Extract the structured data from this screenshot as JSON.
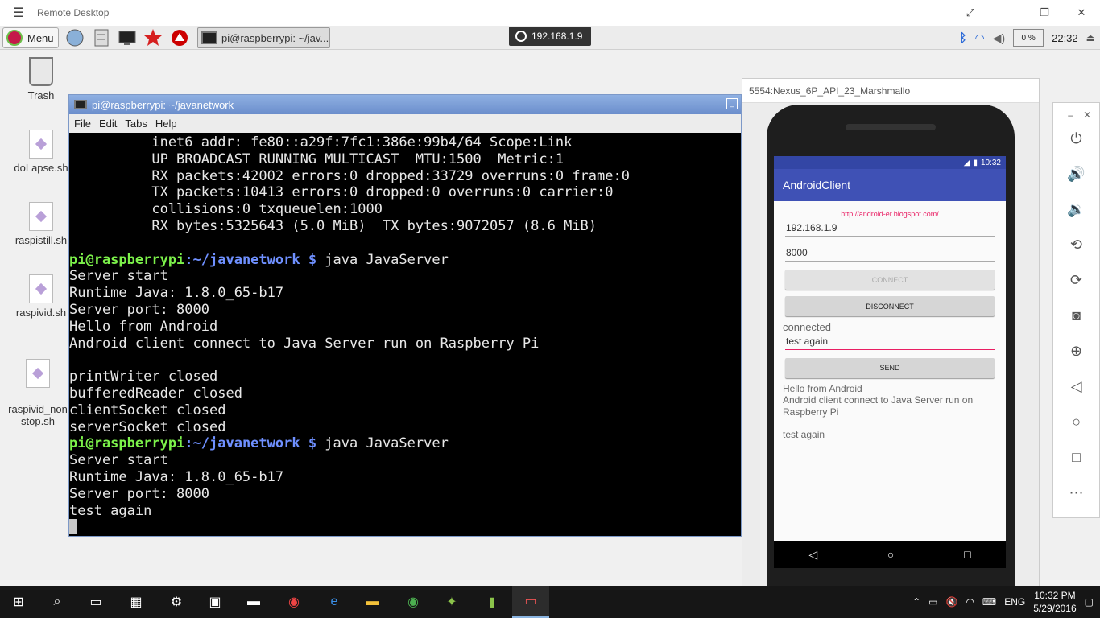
{
  "remote_desktop": {
    "title": "Remote Desktop",
    "connection": "192.168.1.9"
  },
  "pi_panel": {
    "menu_label": "Menu",
    "task_terminal": "pi@raspberrypi: ~/jav...",
    "cpu": "0 %",
    "clock": "22:32"
  },
  "desktop_icons": [
    "Trash",
    "doLapse.sh",
    "raspistill.sh",
    "raspivid.sh",
    "raspivid_non\nstop.sh"
  ],
  "terminal": {
    "title": "pi@raspberrypi: ~/javanetwork",
    "menu": [
      "File",
      "Edit",
      "Tabs",
      "Help"
    ],
    "prompt_user": "pi@raspberrypi",
    "prompt_path": ":~/javanetwork $",
    "command": " java JavaServer",
    "lines_top": [
      "          inet6 addr: fe80::a29f:7fc1:386e:99b4/64 Scope:Link",
      "          UP BROADCAST RUNNING MULTICAST  MTU:1500  Metric:1",
      "          RX packets:42002 errors:0 dropped:33729 overruns:0 frame:0",
      "          TX packets:10413 errors:0 dropped:0 overruns:0 carrier:0",
      "          collisions:0 txqueuelen:1000",
      "          RX bytes:5325643 (5.0 MiB)  TX bytes:9072057 (8.6 MiB)",
      ""
    ],
    "lines_mid": [
      "Server start",
      "Runtime Java: 1.8.0_65-b17",
      "Server port: 8000",
      "Hello from Android",
      "Android client connect to Java Server run on Raspberry Pi",
      "",
      "printWriter closed",
      "bufferedReader closed",
      "clientSocket closed",
      "serverSocket closed"
    ],
    "lines_end": [
      "Server start",
      "Runtime Java: 1.8.0_65-b17",
      "Server port: 8000",
      "test again"
    ]
  },
  "emulator": {
    "title": "5554:Nexus_6P_API_23_Marshmallo",
    "status_time": "10:32",
    "app_title": "AndroidClient",
    "link": "http://android-er.blogspot.com/",
    "ip_value": "192.168.1.9",
    "port_value": "8000",
    "connect_label": "CONNECT",
    "disconnect_label": "DISCONNECT",
    "state": "connected",
    "message_value": "test again",
    "send_label": "SEND",
    "received": [
      "Hello from Android",
      "Android client connect to Java Server run on Raspberry Pi"
    ],
    "received_last": "test again"
  },
  "taskbar": {
    "language": "ENG",
    "time": "10:32 PM",
    "date": "5/29/2016"
  }
}
